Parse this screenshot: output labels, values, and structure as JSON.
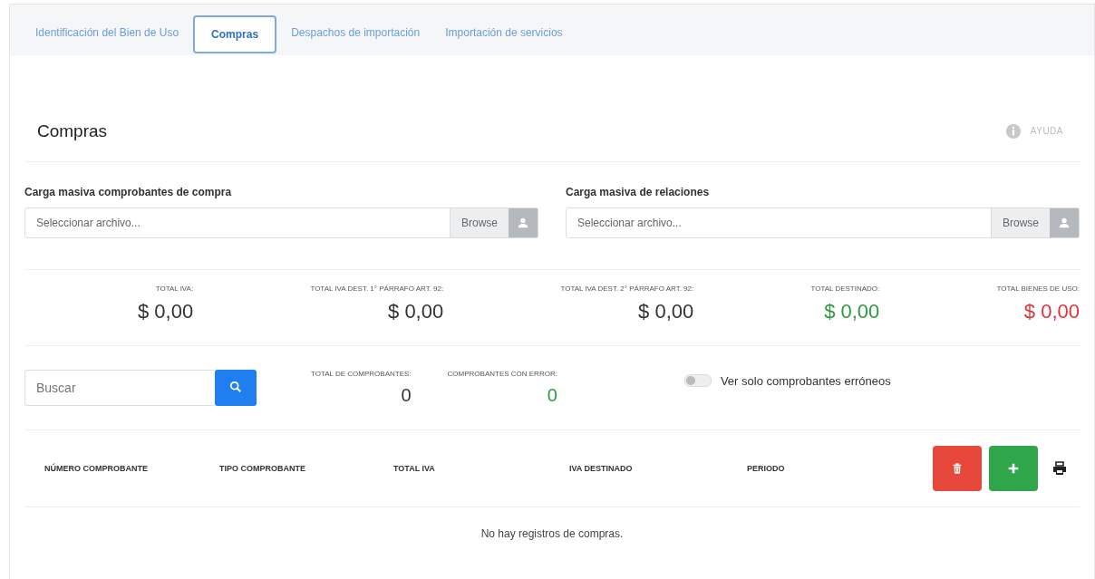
{
  "tabs": [
    {
      "label": "Identificación del Bien de Uso",
      "selected": false
    },
    {
      "label": "Compras",
      "selected": true
    },
    {
      "label": "Despachos de importación",
      "selected": false
    },
    {
      "label": "Importación de servicios",
      "selected": false
    }
  ],
  "section": {
    "title": "Compras",
    "help": "AYUDA"
  },
  "uploads": [
    {
      "label": "Carga masiva comprobantes de compra",
      "placeholder": "Seleccionar archivo...",
      "button": "Browse"
    },
    {
      "label": "Carga masiva de relaciones",
      "placeholder": "Seleccionar archivo...",
      "button": "Browse"
    }
  ],
  "totals": [
    {
      "label": "TOTAL IVA:",
      "value": "$ 0,00",
      "kind": "neutral"
    },
    {
      "label": "TOTAL IVA DEST. 1° PÁRRAFO ART. 92:",
      "value": "$ 0,00",
      "kind": "neutral"
    },
    {
      "label": "TOTAL IVA DEST. 2° PÁRRAFO ART. 92:",
      "value": "$ 0,00",
      "kind": "neutral"
    },
    {
      "label": "TOTAL DESTINADO:",
      "value": "$ 0,00",
      "kind": "positive"
    },
    {
      "label": "TOTAL BIENES DE USO:",
      "value": "$ 0,00",
      "kind": "negative"
    }
  ],
  "search": {
    "placeholder": "Buscar"
  },
  "counts": [
    {
      "label": "TOTAL DE COMPROBANTES:",
      "value": "0",
      "kind": "neutral"
    },
    {
      "label": "COMPROBANTES CON ERROR:",
      "value": "0",
      "kind": "positive"
    }
  ],
  "filter_toggle": {
    "label": "Ver solo comprobantes erróneos",
    "on": false
  },
  "table": {
    "columns": [
      "NÚMERO COMPROBANTE",
      "TIPO COMPROBANTE",
      "TOTAL IVA",
      "IVA DESTINADO",
      "PERIODO"
    ],
    "empty_message": "No hay registros de compras."
  }
}
